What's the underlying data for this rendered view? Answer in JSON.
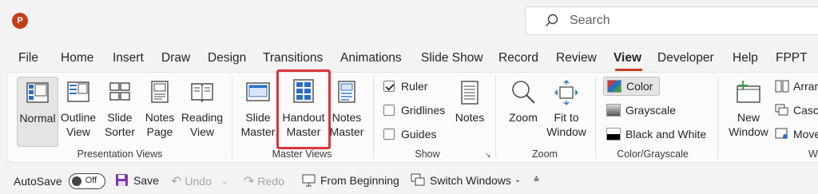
{
  "app": {
    "logo_letter": "P",
    "brand_color": "#c43e1c"
  },
  "search": {
    "placeholder": "Search"
  },
  "tabs": [
    {
      "label": "File"
    },
    {
      "label": "Home"
    },
    {
      "label": "Insert"
    },
    {
      "label": "Draw"
    },
    {
      "label": "Design"
    },
    {
      "label": "Transitions"
    },
    {
      "label": "Animations"
    },
    {
      "label": "Slide Show"
    },
    {
      "label": "Record"
    },
    {
      "label": "Review"
    },
    {
      "label": "View",
      "active": true
    },
    {
      "label": "Developer"
    },
    {
      "label": "Help"
    },
    {
      "label": "FPPT"
    }
  ],
  "groups": {
    "presentation_views": {
      "label": "Presentation Views",
      "buttons": [
        {
          "line1": "Normal",
          "line2": "",
          "selected": true
        },
        {
          "line1": "Outline",
          "line2": "View"
        },
        {
          "line1": "Slide",
          "line2": "Sorter"
        },
        {
          "line1": "Notes",
          "line2": "Page"
        },
        {
          "line1": "Reading",
          "line2": "View"
        }
      ]
    },
    "master_views": {
      "label": "Master Views",
      "buttons": [
        {
          "line1": "Slide",
          "line2": "Master"
        },
        {
          "line1": "Handout",
          "line2": "Master",
          "highlighted": true
        },
        {
          "line1": "Notes",
          "line2": "Master"
        }
      ]
    },
    "show": {
      "label": "Show",
      "checkboxes": [
        {
          "label": "Ruler",
          "checked": true
        },
        {
          "label": "Gridlines",
          "checked": false
        },
        {
          "label": "Guides",
          "checked": false
        }
      ],
      "notes_button": "Notes"
    },
    "zoom": {
      "label": "Zoom",
      "buttons": [
        {
          "line1": "Zoom",
          "line2": ""
        },
        {
          "line1": "Fit to",
          "line2": "Window"
        }
      ]
    },
    "color_grayscale": {
      "label": "Color/Grayscale",
      "options": [
        {
          "label": "Color",
          "selected": true
        },
        {
          "label": "Grayscale"
        },
        {
          "label": "Black and White"
        }
      ]
    },
    "window": {
      "label": "W",
      "new_window": {
        "line1": "New",
        "line2": "Window"
      },
      "items": [
        {
          "label": "Arrar"
        },
        {
          "label": "Casc"
        },
        {
          "label": "Move"
        }
      ]
    }
  },
  "qat": {
    "autosave": "AutoSave",
    "autosave_state": "Off",
    "save": "Save",
    "undo": "Undo",
    "redo": "Redo",
    "from_beginning": "From Beginning",
    "switch_windows": "Switch Windows"
  },
  "colors": {
    "highlight_box": "#d9343b",
    "accent_tab": "#c43e1c"
  }
}
